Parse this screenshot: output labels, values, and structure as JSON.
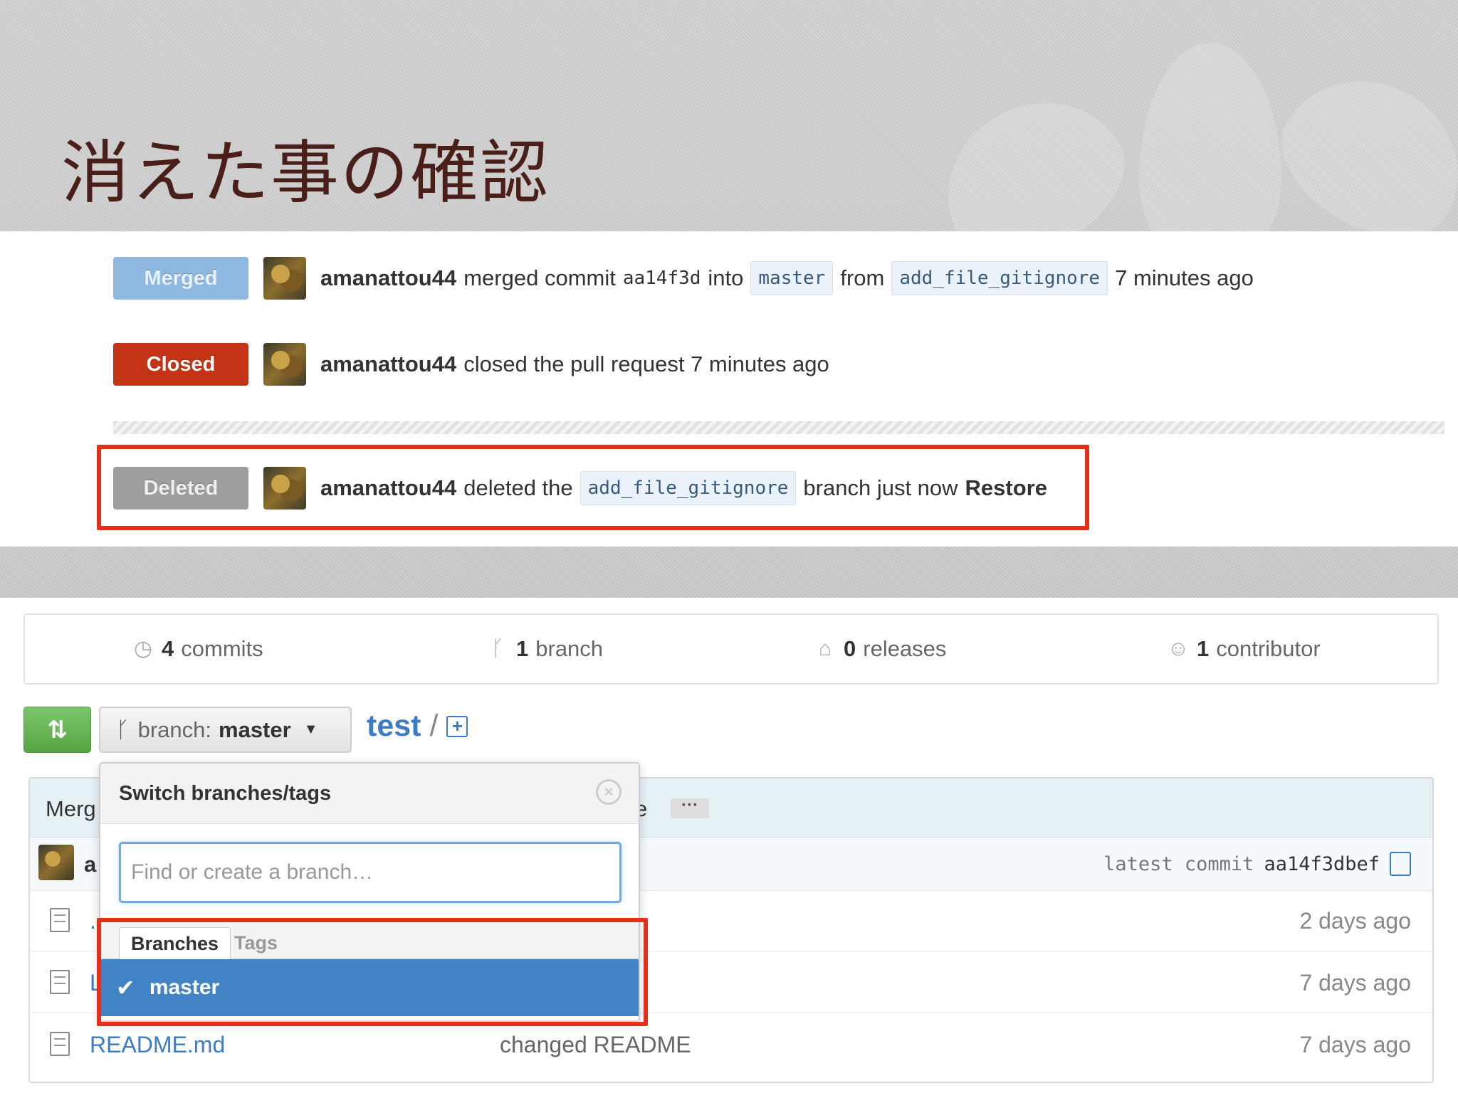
{
  "slide": {
    "title": "消えた事の確認"
  },
  "timeline": {
    "events": [
      {
        "badge": "Merged",
        "user": "amanattou44",
        "text1": "merged commit",
        "commit": "aa14f3d",
        "text2": "into",
        "base_branch": "master",
        "text3": "from",
        "head_branch": "add_file_gitignore",
        "time": "7 minutes ago"
      },
      {
        "badge": "Closed",
        "user": "amanattou44",
        "text1": "closed the pull request 7 minutes ago"
      },
      {
        "badge": "Deleted",
        "user": "amanattou44",
        "text1": "deleted the",
        "branch": "add_file_gitignore",
        "text2": "branch just now",
        "restore": "Restore"
      }
    ]
  },
  "repo": {
    "stats": [
      {
        "icon": "history-icon",
        "count": "4",
        "label": "commits"
      },
      {
        "icon": "branch-icon",
        "count": "1",
        "label": "branch"
      },
      {
        "icon": "tag-icon",
        "count": "0",
        "label": "releases"
      },
      {
        "icon": "people-icon",
        "count": "1",
        "label": "contributor"
      }
    ],
    "branch_label": "branch:",
    "branch_name": "master",
    "repo_name": "test",
    "path_sep": "/",
    "commit_header_left": "Merg",
    "commit_header_right": "e",
    "ellipsis": "···",
    "commit_author_partial": "a",
    "latest_commit_label": "latest commit",
    "latest_commit_sha": "aa14f3dbef",
    "files": [
      {
        "name": ".",
        "message": "",
        "age": "2 days ago"
      },
      {
        "name": "L",
        "message": "",
        "age": "7 days ago"
      },
      {
        "name": "README.md",
        "message": "changed README",
        "age": "7 days ago"
      }
    ]
  },
  "dropdown": {
    "title": "Switch branches/tags",
    "close": "×",
    "search_placeholder": "Find or create a branch…",
    "tabs": [
      "Branches",
      "Tags"
    ],
    "items": [
      {
        "check": "✔",
        "label": "master"
      }
    ]
  },
  "colors": {
    "highlight_red": "#e4301b",
    "merged": "#8fb8e0",
    "closed": "#c53316",
    "deleted": "#9e9e9e",
    "link_blue": "#3d7cc2",
    "selected_blue": "#4183c4"
  }
}
